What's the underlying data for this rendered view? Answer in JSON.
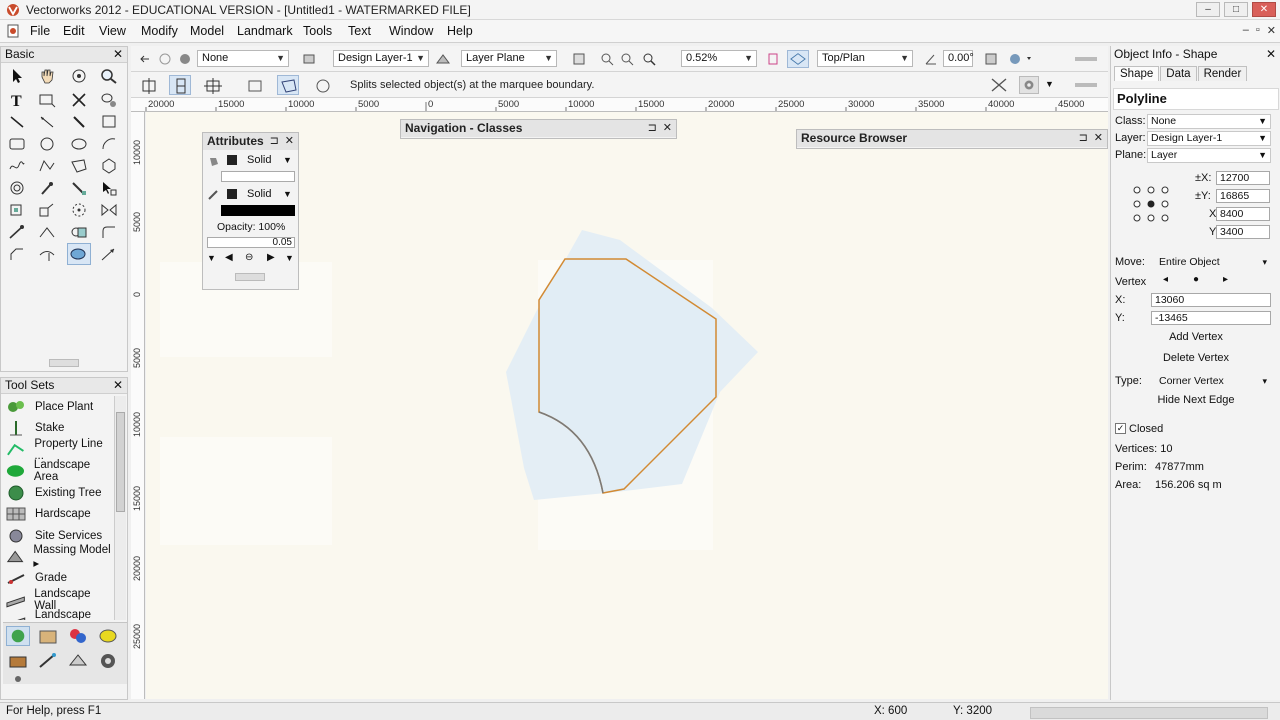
{
  "window": {
    "title": "Vectorworks 2012 - EDUCATIONAL VERSION - [Untitled1 - WATERMARKED FILE]",
    "controls": [
      "–",
      "□",
      "✕"
    ]
  },
  "menubar": {
    "items": [
      "File",
      "Edit",
      "View",
      "Modify",
      "Model",
      "Landmark",
      "Tools",
      "Text",
      "Window",
      "Help"
    ],
    "mdi_controls": [
      "–",
      "▫",
      "✕"
    ]
  },
  "basic_palette": {
    "title": "Basic",
    "close": "✕"
  },
  "tool_sets": {
    "title": "Tool Sets",
    "close": "✕",
    "items": [
      {
        "label": "Place Plant",
        "icon": "plant-icon"
      },
      {
        "label": "Stake",
        "icon": "stake-icon"
      },
      {
        "label": "Property Line ...",
        "icon": "property-line-icon"
      },
      {
        "label": "Landscape Area",
        "icon": "landscape-area-icon"
      },
      {
        "label": "Existing Tree",
        "icon": "existing-tree-icon"
      },
      {
        "label": "Hardscape",
        "icon": "hardscape-icon"
      },
      {
        "label": "Site Services",
        "icon": "site-services-icon"
      },
      {
        "label": "Massing Model ▸",
        "icon": "massing-model-icon"
      },
      {
        "label": "Grade",
        "icon": "grade-icon"
      },
      {
        "label": "Landscape Wall",
        "icon": "landscape-wall-icon"
      },
      {
        "label": "Landscape W...",
        "icon": "landscape-wall-2-icon"
      }
    ]
  },
  "view_bar": {
    "class_value": "None",
    "layer_value": "Design Layer-1",
    "plane_value": "Layer Plane",
    "zoom_value": "0.52%",
    "view_value": "Top/Plan",
    "angle_value": "0.00°"
  },
  "mode_bar": {
    "message": "Splits selected object(s) at the marquee boundary."
  },
  "ruler": {
    "h_labels": [
      "20000",
      "15000",
      "10000",
      "5000",
      "0",
      "5000",
      "10000",
      "15000",
      "20000",
      "25000",
      "30000",
      "35000",
      "40000",
      "45000"
    ],
    "v_labels": [
      "10000",
      "5000",
      "0",
      "5000",
      "10000",
      "15000",
      "20000",
      "25000"
    ]
  },
  "attributes": {
    "title": "Attributes",
    "fill_style": "Solid",
    "pen_style": "Solid",
    "opacity": "Opacity: 100%",
    "line_weight": "0.05"
  },
  "navigation": {
    "title": "Navigation - Classes"
  },
  "resource_browser": {
    "title": "Resource Browser"
  },
  "object_info": {
    "title": "Object Info - Shape",
    "tabs": [
      "Shape",
      "Data",
      "Render"
    ],
    "object_type": "Polyline",
    "class_label": "Class:",
    "class_value": "None",
    "layer_label": "Layer:",
    "layer_value": "Design Layer-1",
    "plane_label": "Plane:",
    "plane_value": "Layer",
    "dx_label": "±X:",
    "dx_value": "12700",
    "dy_label": "±Y:",
    "dy_value": "16865",
    "x_label": "X:",
    "x_value": "8400",
    "y_label": "Y:",
    "y_value": "3400",
    "move_label": "Move:",
    "move_value": "Entire Object",
    "vertex_label": "Vertex",
    "vx_label": "X:",
    "vx_value": "13060",
    "vy_label": "Y:",
    "vy_value": "-13465",
    "add_vertex": "Add Vertex",
    "delete_vertex": "Delete Vertex",
    "type_label": "Type:",
    "type_value": "Corner Vertex",
    "hide_next_edge": "Hide Next Edge",
    "closed_label": "Closed",
    "vertices": "Vertices: 10",
    "perim_label": "Perim:",
    "perim_value": "47877mm",
    "area_label": "Area:",
    "area_value": "156.206 sq m"
  },
  "status_bar": {
    "help": "For Help, press F1",
    "x": "X: 600",
    "y": "Y: 3200"
  },
  "colors": {
    "polyline_stroke": "#d28a33",
    "shape_fill": "#e4eef5",
    "canvas": "#faf8ef",
    "active_tool": "#d8e6f5"
  }
}
